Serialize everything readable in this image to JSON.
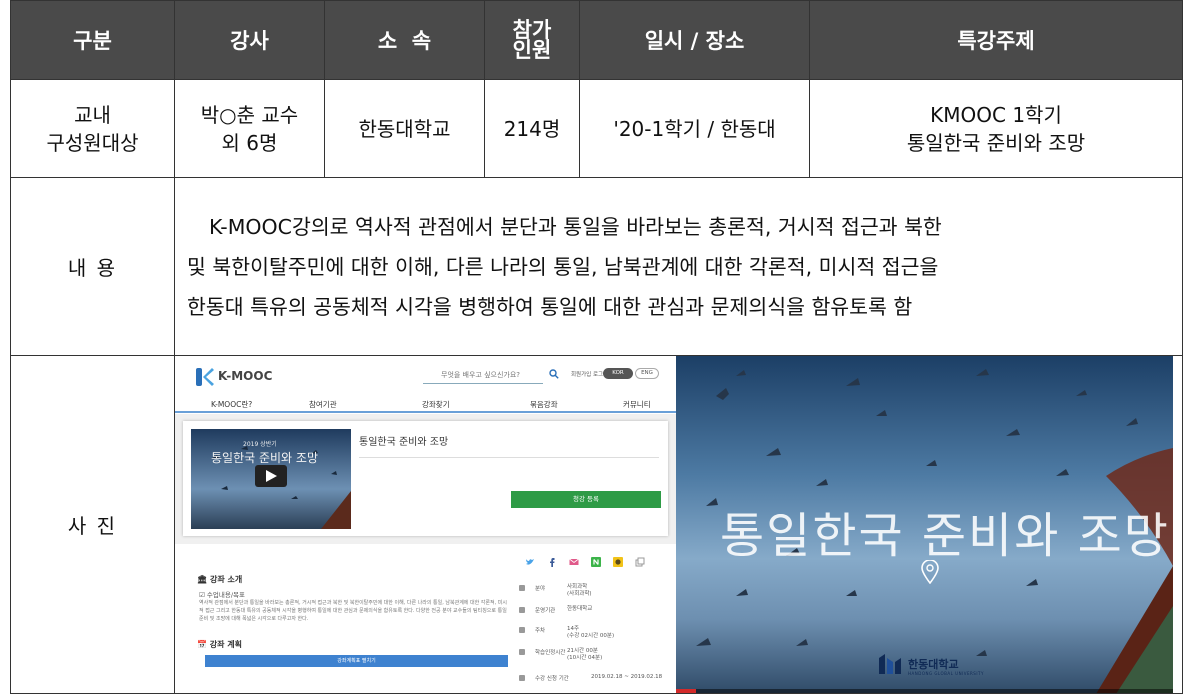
{
  "header": {
    "col1": "구분",
    "col2": "강사",
    "col3": "소  속",
    "col4_line1": "참가",
    "col4_line2": "인원",
    "col5": "일시 / 장소",
    "col6": "특강주제"
  },
  "row": {
    "category_line1": "교내",
    "category_line2": "구성원대상",
    "lecturer_line1": "박○춘 교수",
    "lecturer_line2": "외 6명",
    "affiliation": "한동대학교",
    "participants": "214명",
    "datetime_place": "'20-1학기 / 한동대",
    "topic_line1": "KMOOC 1학기",
    "topic_line2": "통일한국 준비와 조망"
  },
  "content": {
    "label": "내 용",
    "line1": "K-MOOC강의로 역사적 관점에서 분단과 통일을 바라보는 총론적, 거시적 접근과 북한",
    "line2": "및 북한이탈주민에 대한 이해, 다른 나라의 통일, 남북관계에 대한 각론적, 미시적 접근을",
    "line3": "한동대 특유의 공동체적 시각을 병행하여 통일에 대한 관심과 문제의식을 함유토록 함"
  },
  "photo": {
    "label": "사 진",
    "kmooc": {
      "logo_text": "K-MOOC",
      "search_placeholder": "무엇을 배우고 싶으신가요?",
      "util_text": "회원가입 로그인",
      "lang_kor": "KOR",
      "lang_eng": "ENG",
      "nav": [
        "K-MOOC란?",
        "참여기관",
        "강좌찾기",
        "묶음강좌",
        "커뮤니티"
      ],
      "thumb_caption_top": "2019 상반기",
      "thumb_caption": "통일한국 준비와 조망",
      "course_title": "통일한국 준비와 조망",
      "register_label": "청강 등록",
      "section_intro": "강좌 소개",
      "subsection": "수업내용/목표",
      "intro_text": "역사적 관점에서 분단과 통일을 바라보는 총론적, 거시적 접근과 북한 및 북한이탈주민에 대한 이해, 다른 나라의 통일, 남북관계에 대한 각론적, 미시적 접근 그리고 한동대 특유의 공동체적 시각을 병행하여 통일에 대한 관심과 문제의식을 함유토록 한다. 다양한 전공 분야 교수들의 팀티칭으로 통일 준비 및 조망에 대해 폭넓은 시각으로 다루고자 한다.",
      "section_plan": "강좌 계획",
      "plan_button": "강좌계획표 펼치기",
      "info": [
        {
          "k": "분야",
          "v1": "사회과학",
          "v2": "(사회과학)"
        },
        {
          "k": "운영기관",
          "v1": "한동대학교",
          "v2": ""
        },
        {
          "k": "주차",
          "v1": "14주",
          "v2": "(수강 02시간 00분)"
        },
        {
          "k": "학습인정시간",
          "v1": "21시간 00분",
          "v2": "(10시간 04분)"
        },
        {
          "k": "수강 신청 기간",
          "v1": "2019.02.18 ~ 2019.02.18",
          "v2": ""
        }
      ]
    },
    "video": {
      "title": "통일한국 준비와 조망",
      "brand": "한동대학교",
      "brand_sub": "HANDONG GLOBAL UNIVERSITY",
      "progress": 0.04
    }
  }
}
